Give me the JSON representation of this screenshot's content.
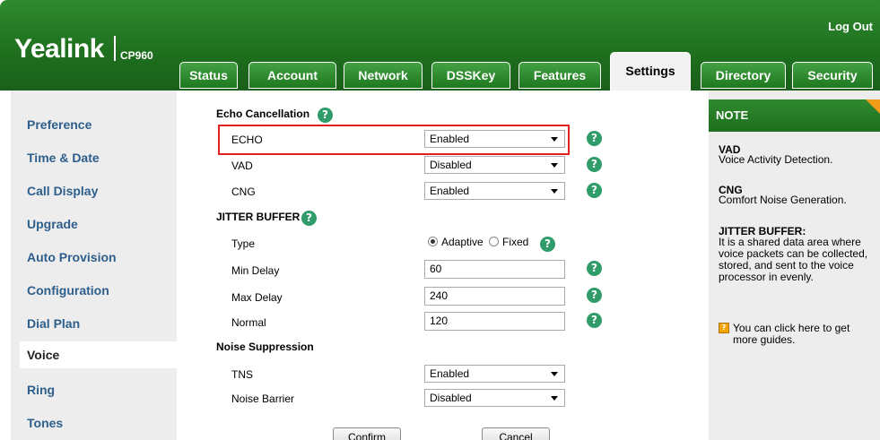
{
  "header": {
    "logo": "Yealink",
    "model": "CP960",
    "logout": "Log Out"
  },
  "tabs": [
    {
      "label": "Status"
    },
    {
      "label": "Account"
    },
    {
      "label": "Network"
    },
    {
      "label": "DSSKey"
    },
    {
      "label": "Features"
    },
    {
      "label": "Settings",
      "active": true
    },
    {
      "label": "Directory"
    },
    {
      "label": "Security"
    }
  ],
  "sidebar": {
    "items": [
      {
        "label": "Preference"
      },
      {
        "label": "Time & Date"
      },
      {
        "label": "Call Display"
      },
      {
        "label": "Upgrade"
      },
      {
        "label": "Auto Provision"
      },
      {
        "label": "Configuration"
      },
      {
        "label": "Dial Plan"
      },
      {
        "label": "Voice",
        "active": true
      },
      {
        "label": "Ring"
      },
      {
        "label": "Tones"
      }
    ]
  },
  "form": {
    "echo_section": "Echo Cancellation",
    "echo": {
      "label": "ECHO",
      "value": "Enabled"
    },
    "vad": {
      "label": "VAD",
      "value": "Disabled"
    },
    "cng": {
      "label": "CNG",
      "value": "Enabled"
    },
    "jitter_section": "JITTER BUFFER",
    "type": {
      "label": "Type",
      "option1": "Adaptive",
      "option2": "Fixed",
      "selected": "Adaptive"
    },
    "min_delay": {
      "label": "Min Delay",
      "value": "60"
    },
    "max_delay": {
      "label": "Max Delay",
      "value": "240"
    },
    "normal": {
      "label": "Normal",
      "value": "120"
    },
    "noise_section": "Noise Suppression",
    "tns": {
      "label": "TNS",
      "value": "Enabled"
    },
    "noise_barrier": {
      "label": "Noise Barrier",
      "value": "Disabled"
    },
    "confirm": "Confirm",
    "cancel": "Cancel"
  },
  "note": {
    "title": "NOTE",
    "vad_title": "VAD",
    "vad_desc": "Voice Activity Detection.",
    "cng_title": "CNG",
    "cng_desc": "Comfort Noise Generation.",
    "jitter_title": "JITTER BUFFER:",
    "jitter_desc": "It is a shared data area where voice packets can be collected, stored, and sent to the voice processor in evenly.",
    "guide": "You can click here to get more guides."
  },
  "colors": {
    "header_green": "#1e6f1e",
    "nav_blue": "#2d5e8c",
    "help_green": "#2f9c6a",
    "highlight_red": "#e02020",
    "note_corner": "#f29b1a"
  }
}
